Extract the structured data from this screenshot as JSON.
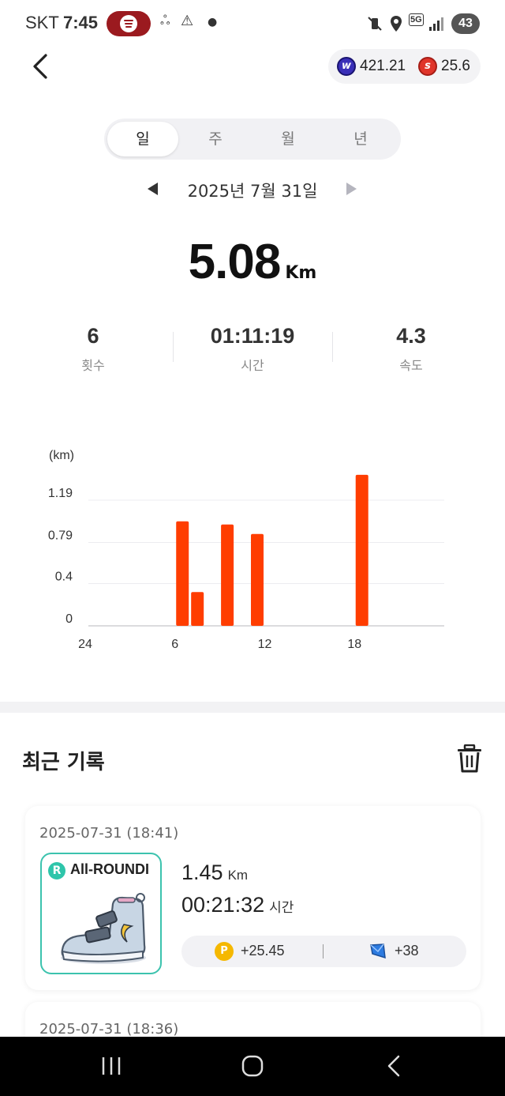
{
  "status_bar": {
    "carrier": "SKT",
    "time": "7:45",
    "battery": "43",
    "network": "5G"
  },
  "header": {
    "balance_w": "421.21",
    "balance_s": "25.6",
    "coin_w_letter": "w",
    "coin_s_letter": "s"
  },
  "tabs": [
    {
      "label": "일",
      "active": true
    },
    {
      "label": "주",
      "active": false
    },
    {
      "label": "월",
      "active": false
    },
    {
      "label": "년",
      "active": false
    }
  ],
  "date": "2025년 7월 31일",
  "total": {
    "distance": "5.08",
    "unit": "Km"
  },
  "stats": [
    {
      "value": "6",
      "label": "횟수"
    },
    {
      "value": "01:11:19",
      "label": "시간"
    },
    {
      "value": "4.3",
      "label": "속도"
    }
  ],
  "chart_data": {
    "type": "bar",
    "ylabel": "(km)",
    "yticks": [
      "1.19",
      "0.79",
      "0.4",
      "0"
    ],
    "ylim": [
      0,
      1.19
    ],
    "xticks": [
      "24",
      "6",
      "12",
      "18"
    ],
    "xlim": [
      0,
      24
    ],
    "grid": true,
    "color": "#ff3d00",
    "bars": [
      {
        "hour": 6,
        "value": 0.99
      },
      {
        "hour": 7,
        "value": 0.32
      },
      {
        "hour": 9,
        "value": 0.96
      },
      {
        "hour": 11,
        "value": 0.87
      },
      {
        "hour": 18,
        "value": 1.43
      }
    ]
  },
  "recent": {
    "title": "최근 기록",
    "records": [
      {
        "date": "2025-07-31 (18:41)",
        "shoe_name": "All-ROUNDI",
        "shoe_badge": "R",
        "distance": "1.45",
        "distance_unit": "Km",
        "duration": "00:21:32",
        "duration_unit": "시간",
        "reward_points_icon": "P",
        "reward_points": "+25.45",
        "reward_gems": "+38"
      },
      {
        "date": "2025-07-31 (18:36)"
      }
    ]
  },
  "colors": {
    "accent": "#ff3d00",
    "teal": "#2ec5aa",
    "coin_gold": "#f5b800"
  }
}
